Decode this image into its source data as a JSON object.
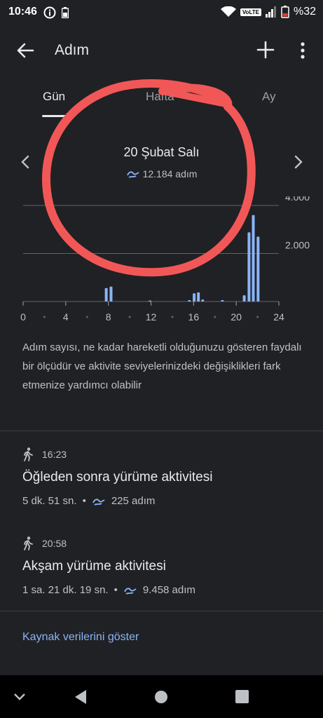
{
  "status": {
    "time": "10:46",
    "volte": "VoLTE",
    "battery": "%32"
  },
  "appbar": {
    "title": "Adım",
    "icons": [
      "back-arrow-icon",
      "add-icon",
      "more-vert-icon"
    ]
  },
  "tabs": [
    {
      "label": "Gün",
      "active": true
    },
    {
      "label": "Hafta",
      "active": false
    },
    {
      "label": "Ay",
      "active": false
    }
  ],
  "date_header": {
    "date": "20 Şubat Salı",
    "steps": "12.184 adım"
  },
  "chart_data": {
    "type": "bar",
    "x_ticks": [
      "0",
      "4",
      "8",
      "12",
      "16",
      "20",
      "24"
    ],
    "y_ticks": [
      "4.000",
      "2.000"
    ],
    "ylim": [
      0,
      4000
    ],
    "xlim": [
      0,
      24
    ],
    "bar_color": "#8ab4f8",
    "x": [
      7.8,
      8.25,
      11.9,
      15.6,
      16.05,
      16.45,
      16.85,
      18.7,
      20.75,
      21.2,
      21.6,
      22.05
    ],
    "values": [
      560,
      620,
      40,
      60,
      340,
      380,
      80,
      60,
      260,
      2880,
      3600,
      2700
    ]
  },
  "description": "Adım sayısı, ne kadar hareketli olduğunuzu gösteren faydalı bir ölçüdür ve aktivite seviyelerinizdeki değişiklikleri fark etmenize yardımcı olabilir",
  "activities": [
    {
      "time": "16:23",
      "name": "Öğleden sonra yürüme aktivitesi",
      "duration": "5 dk. 51 sn.",
      "steps": "225 adım"
    },
    {
      "time": "20:58",
      "name": "Akşam yürüme aktivitesi",
      "duration": "1 sa. 21 dk. 19 sn.",
      "steps": "9.458 adım"
    }
  ],
  "source_link": "Kaynak verilerini göster",
  "colors": {
    "background": "#202124",
    "accent": "#8ab4f8",
    "annotation": "#f25757"
  }
}
